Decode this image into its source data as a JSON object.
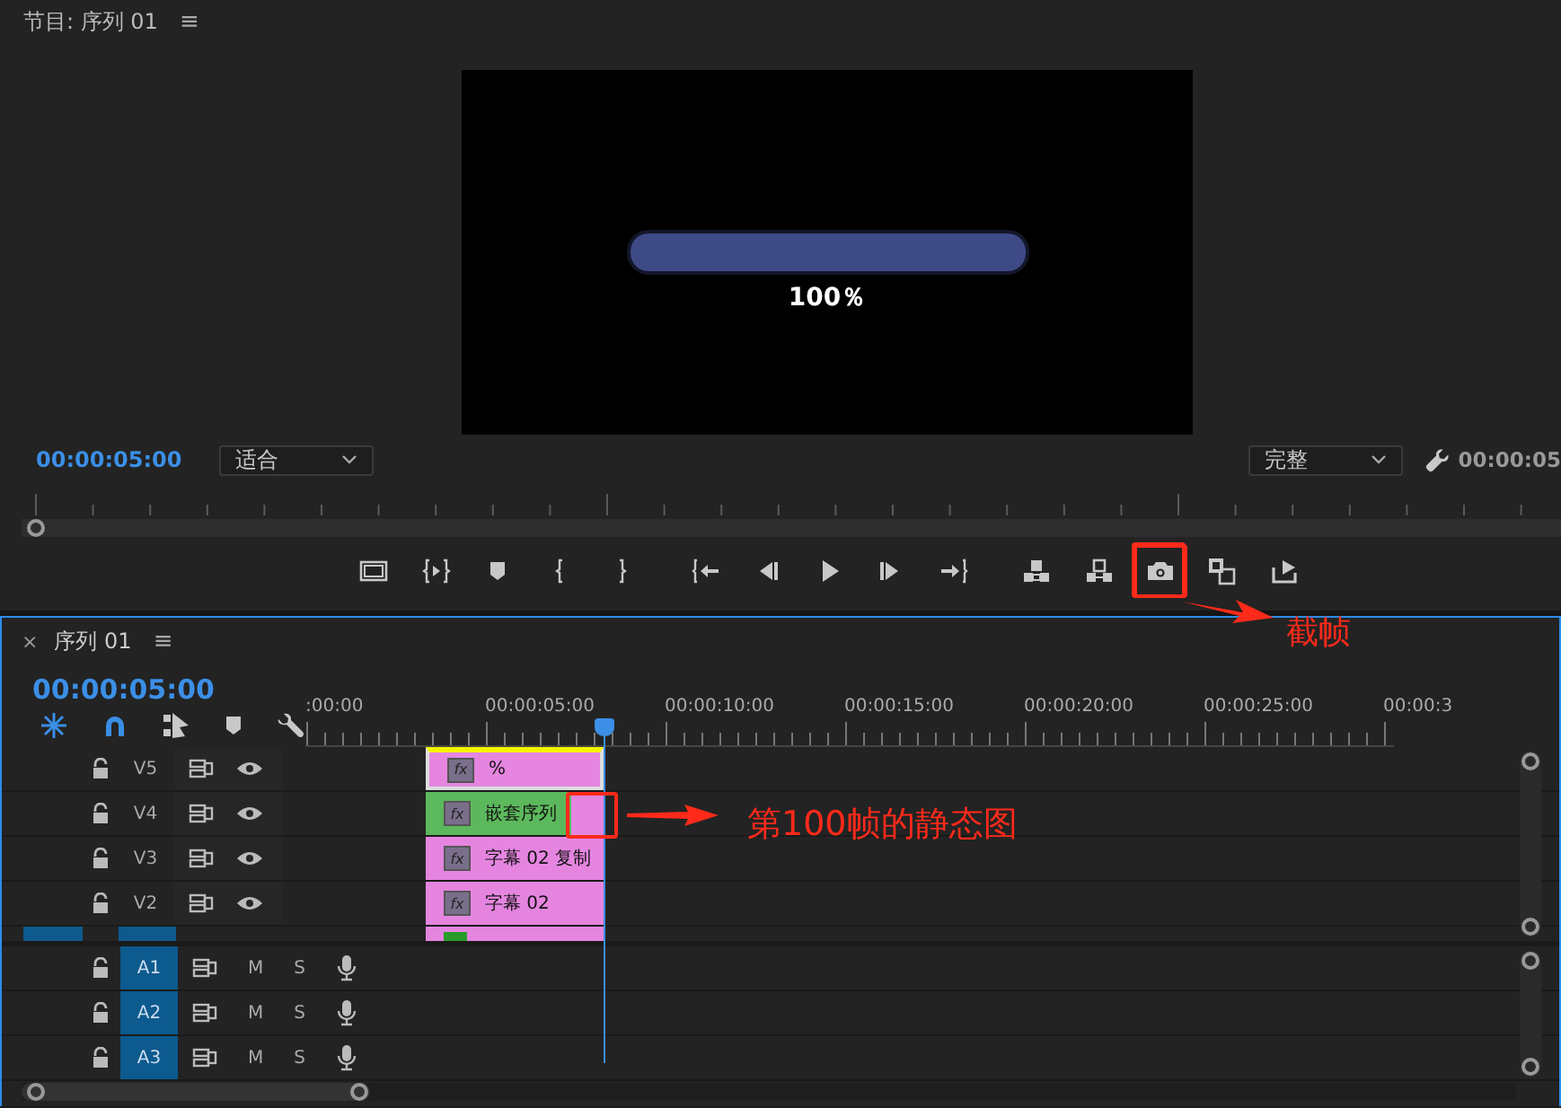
{
  "program_monitor": {
    "title": "节目: 序列 01",
    "menu": "≡",
    "frame": {
      "progress_bar": {
        "level": 1
      },
      "progress_text": "100％"
    },
    "timecode": "00:00:05:00",
    "fit_dropdown": "适合",
    "quality_dropdown": "完整",
    "end_timecode": "00:00:05",
    "transport_buttons": [
      {
        "kind": "safe-margins",
        "highlighted": false
      },
      {
        "kind": "play-in-out",
        "highlighted": false
      },
      {
        "kind": "marker",
        "highlighted": false
      },
      {
        "kind": "mark-in",
        "highlighted": false
      },
      {
        "kind": "mark-out",
        "highlighted": false
      },
      {
        "kind": "go-to-in",
        "highlighted": false
      },
      {
        "kind": "step-back",
        "highlighted": false
      },
      {
        "kind": "play",
        "highlighted": false
      },
      {
        "kind": "step-forward",
        "highlighted": false
      },
      {
        "kind": "go-to-out",
        "highlighted": false
      },
      {
        "kind": "lift",
        "highlighted": false
      },
      {
        "kind": "extract",
        "highlighted": false
      },
      {
        "kind": "camera",
        "highlighted": true
      },
      {
        "kind": "compare",
        "highlighted": false
      },
      {
        "kind": "export",
        "highlighted": false
      }
    ]
  },
  "timeline": {
    "close": "×",
    "title": "序列 01",
    "menu": "≡",
    "timecode": "00:00:05:00",
    "ruler_labels": [
      ":00:00",
      "00:00:05:00",
      "00:00:10:00",
      "00:00:15:00",
      "00:00:20:00",
      "00:00:25:00",
      "00:00:3"
    ],
    "video_tracks": [
      {
        "name": "V5",
        "clip": {
          "kind": "title",
          "fx": "fx",
          "label": "%",
          "selected": true
        }
      },
      {
        "name": "V4",
        "clip": {
          "kind": "nested",
          "fx": "fx",
          "label": "嵌套序列",
          "selected": false
        }
      },
      {
        "name": "V3",
        "clip": {
          "kind": "title",
          "fx": "fx",
          "label": "字幕 02 复制",
          "selected": false
        }
      },
      {
        "name": "V2",
        "clip": {
          "kind": "title",
          "fx": "fx",
          "label": "字幕 02",
          "selected": false
        }
      }
    ],
    "audio_tracks": [
      {
        "name": "A1",
        "targeted": true,
        "mute": "M",
        "solo": "S"
      },
      {
        "name": "A2",
        "targeted": true,
        "mute": "M",
        "solo": "S"
      },
      {
        "name": "A3",
        "targeted": true,
        "mute": "M",
        "solo": "S"
      }
    ]
  },
  "annotations": [
    {
      "text": "截帧"
    },
    {
      "text": "第100帧的静态图"
    }
  ]
}
